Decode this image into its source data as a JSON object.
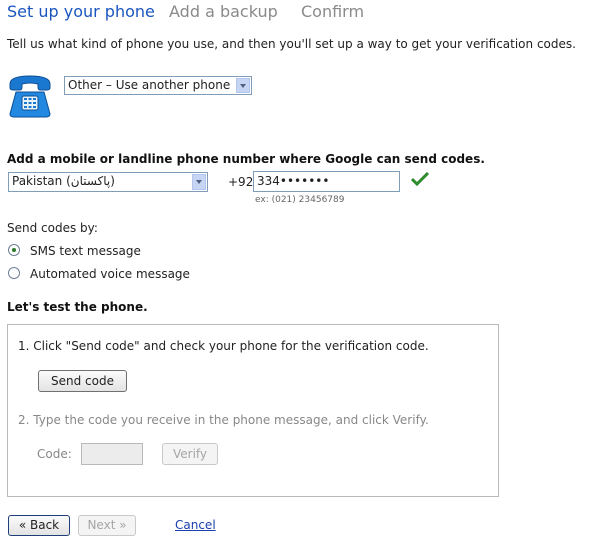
{
  "steps": [
    {
      "label": "Set up your phone",
      "active": true
    },
    {
      "label": "Add a backup",
      "active": false
    },
    {
      "label": "Confirm",
      "active": false
    }
  ],
  "intro_text": "Tell us what kind of phone you use, and then you'll set up a way to get your verification codes.",
  "phone_type": {
    "selected": "Other – Use another phone",
    "icon": "telephone-icon"
  },
  "phone_number": {
    "label": "Add a mobile or landline phone number where Google can send codes.",
    "country_selected": "Pakistan (پاکستان)",
    "country_code": "+92",
    "value": "334•••••••",
    "example": "ex: (021) 23456789",
    "valid_icon": "checkmark-icon",
    "valid_color": "#2e8b2e"
  },
  "send_codes": {
    "label": "Send codes by:",
    "options": [
      {
        "label": "SMS text message",
        "checked": true
      },
      {
        "label": "Automated voice message",
        "checked": false
      }
    ]
  },
  "test": {
    "heading": "Let's test the phone.",
    "step1": "1.  Click \"Send code\" and check your phone for the verification code.",
    "send_button": "Send code",
    "step2": "2.  Type the code you receive in the phone message, and click Verify.",
    "code_label": "Code:",
    "verify_button": "Verify"
  },
  "nav": {
    "back": "« Back",
    "next": "Next »",
    "cancel": "Cancel"
  },
  "colors": {
    "active_step": "#1a55c0",
    "inactive_step": "#8a8a8a",
    "link": "#1a3fae"
  }
}
